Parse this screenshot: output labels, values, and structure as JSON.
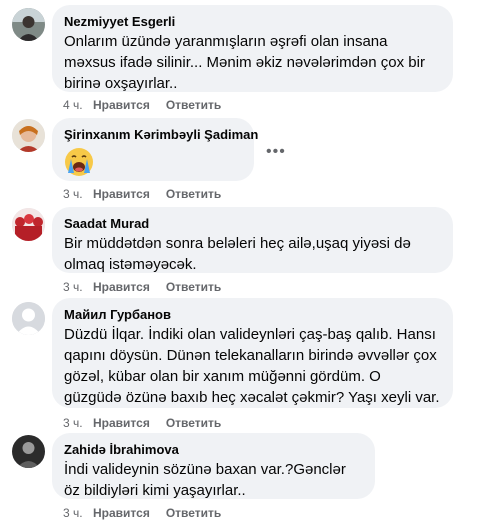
{
  "comments": [
    {
      "author": "Nezmiyyet Esgerli",
      "text": "Onlarım üzündə yaranmışların əşrəfi olan insana məxsus ifadə silinir... Mənim əkiz nəvələrimdən çox bir birinə oxşayırlar..",
      "time": "4 ч.",
      "like": "Нравится",
      "reply": "Ответить"
    },
    {
      "author": "Şirinxanım Kərimbəyli Şadiman",
      "emoji": "crying-face",
      "time": "3 ч.",
      "like": "Нравится",
      "reply": "Ответить",
      "more": "•••"
    },
    {
      "author": "Saadat Murad",
      "text": "Bir müddətdən sonra beləleri heç ailə,uşaq yiyəsi də olmaq istəməyəcək.",
      "time": "3 ч.",
      "like": "Нравится",
      "reply": "Ответить"
    },
    {
      "author": "Майил Гурбанов",
      "text": "Düzdü İlqar. İndiki olan valideynləri çaş-baş qalıb. Hansı qapını döysün. Dünən telekanalların birində əvvəllər çox gözəl, kübar olan bir xanım müğənni gördüm. O güzgüdə özünə baxıb heç xəcalət çəkmir? Yaşı xeyli var.",
      "time": "3 ч.",
      "like": "Нравится",
      "reply": "Ответить"
    },
    {
      "author": "Zahidə İbrahimova",
      "text": "İndi valideynin sözünə baxan var.?Gənclər öz bildiyləri kimi yaşayırlar..",
      "time": "3 ч.",
      "like": "Нравится",
      "reply": "Ответить"
    }
  ]
}
